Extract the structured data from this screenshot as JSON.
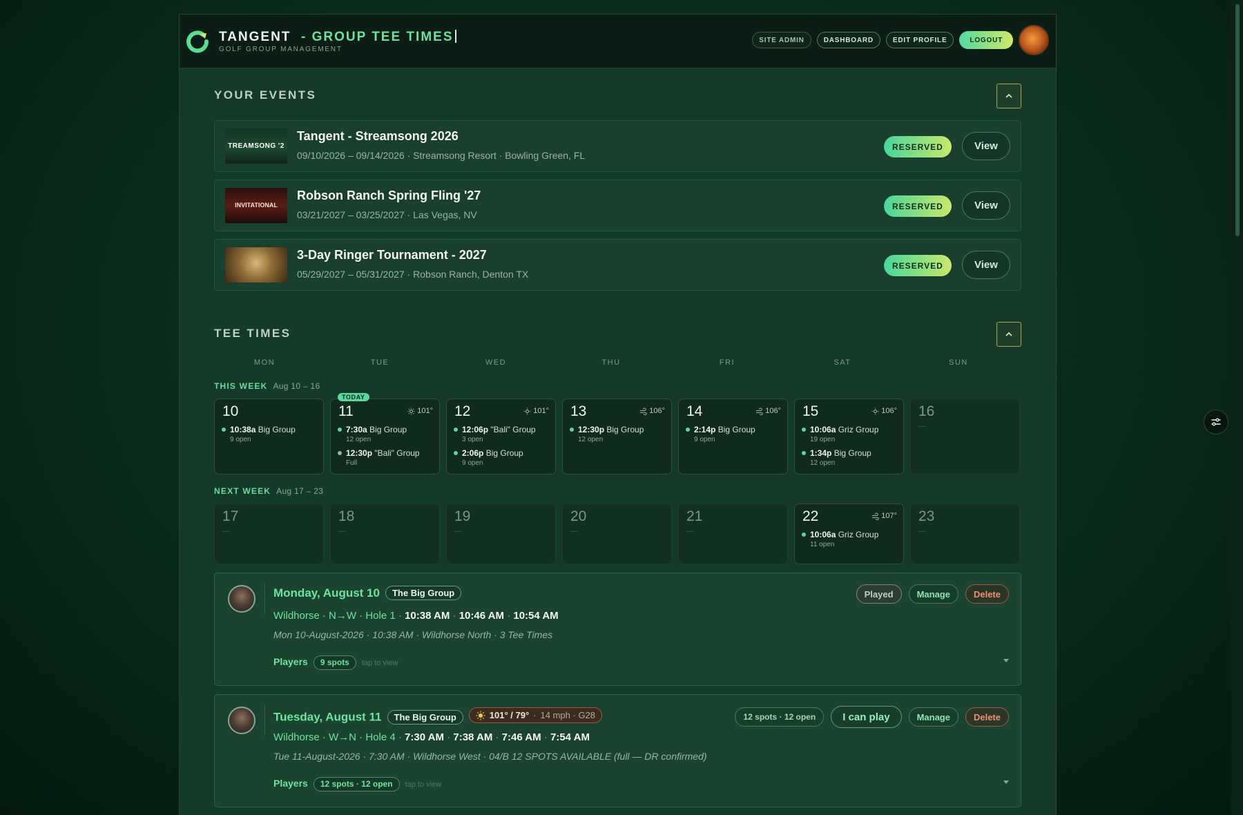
{
  "header": {
    "brand": "TANGENT",
    "brand_suffix": "- GROUP TEE TIMES",
    "subtitle": "GOLF GROUP MANAGEMENT",
    "nav": [
      "SITE ADMIN",
      "DASHBOARD",
      "EDIT PROFILE"
    ],
    "logout_label": "LOGOUT"
  },
  "events_section": {
    "title": "YOUR EVENTS",
    "items": [
      {
        "title": "Tangent - Streamsong 2026",
        "subtitle": "09/10/2026 – 09/14/2026 · Streamsong Resort · Bowling Green, FL",
        "thumb_text": "TREAMSONG '2",
        "status": "RESERVED",
        "action": "View"
      },
      {
        "title": "Robson Ranch Spring Fling '27",
        "subtitle": "03/21/2027 – 03/25/2027 · Las Vegas, NV",
        "thumb_text": "INVITATIONAL",
        "status": "RESERVED",
        "action": "View"
      },
      {
        "title": "3-Day Ringer Tournament - 2027",
        "subtitle": "05/29/2027 – 05/31/2027 · Robson Ranch, Denton TX",
        "thumb_text": "",
        "status": "RESERVED",
        "action": "View"
      }
    ]
  },
  "tee_times": {
    "title": "TEE TIMES",
    "days_of_week": [
      "MON",
      "TUE",
      "WED",
      "THU",
      "FRI",
      "SAT",
      "SUN"
    ],
    "this_week": {
      "label": "THIS WEEK",
      "range": "Aug 10 – 16"
    },
    "next_week": {
      "label": "NEXT WEEK",
      "range": "Aug 17 – 23"
    },
    "today_label": "TODAY",
    "empty_dash": "—",
    "week1": [
      {
        "num": "10",
        "slots": [
          {
            "time": "10:38a",
            "group": "Big Group",
            "sub": "9 open"
          }
        ]
      },
      {
        "num": "11",
        "weather_icon": "sun-icon",
        "temp": "101°",
        "slots": [
          {
            "time": "7:30a",
            "group": "Big Group",
            "sub": "12 open"
          },
          {
            "time": "12:30p",
            "group": "\"Bali\" Group",
            "sub": "Full"
          }
        ]
      },
      {
        "num": "12",
        "weather_icon": "sun-icon",
        "temp": "101°",
        "slots": [
          {
            "time": "12:06p",
            "group": "\"Bali\" Group",
            "sub": "3 open"
          },
          {
            "time": "2:06p",
            "group": "Big Group",
            "sub": "9 open"
          }
        ]
      },
      {
        "num": "13",
        "weather_icon": "wind-icon",
        "temp": "106°",
        "slots": [
          {
            "time": "12:30p",
            "group": "Big Group",
            "sub": "12 open"
          }
        ]
      },
      {
        "num": "14",
        "weather_icon": "wind-icon",
        "temp": "106°",
        "slots": [
          {
            "time": "2:14p",
            "group": "Big Group",
            "sub": "9 open"
          }
        ]
      },
      {
        "num": "15",
        "weather_icon": "sun-icon",
        "temp": "106°",
        "slots": [
          {
            "time": "10:06a",
            "group": "Griz Group",
            "sub": "19 open"
          },
          {
            "time": "1:34p",
            "group": "Big Group",
            "sub": "12 open"
          }
        ]
      },
      {
        "num": "16"
      }
    ],
    "week2": [
      {
        "num": "17"
      },
      {
        "num": "18"
      },
      {
        "num": "19"
      },
      {
        "num": "20"
      },
      {
        "num": "21"
      },
      {
        "num": "22",
        "weather_icon": "wind-icon",
        "temp": "107°",
        "slots": [
          {
            "time": "10:06a",
            "group": "Griz Group",
            "sub": "11 open"
          }
        ]
      },
      {
        "num": "23"
      }
    ]
  },
  "cards": [
    {
      "date": "Monday, August 10",
      "group": "The Big Group",
      "route": "Wildhorse · N→W · Hole 1",
      "times": [
        "10:38 AM",
        "10:46 AM",
        "10:54 AM"
      ],
      "note": "Mon 10-August-2026 · 10:38 AM · Wildhorse North · 3 Tee Times",
      "players_label": "Players",
      "spots": "9 spots",
      "tap": "tap to view",
      "actions": [
        "Played",
        "Manage",
        "Delete"
      ]
    },
    {
      "date": "Tuesday, August 11",
      "group": "The Big Group",
      "weather": {
        "temps": "101° / 79°",
        "wind": "14 mph · G28"
      },
      "route": "Wildhorse · W→N · Hole 4",
      "times": [
        "7:30 AM",
        "7:38 AM",
        "7:46 AM",
        "7:54 AM"
      ],
      "note": "Tue 11-August-2026 · 7:30 AM · Wildhorse West · 04/B 12 SPOTS AVAILABLE (full — DR confirmed)",
      "players_label": "Players",
      "spots": "12 spots · 12 open",
      "tap": "tap to view",
      "summary": "12 spots · 12 open",
      "play_label": "I can play",
      "actions": [
        "Manage",
        "Delete"
      ]
    }
  ],
  "colors": {
    "accent": "#6fe39d",
    "background": "#143a2a",
    "danger": "#f08f6f"
  }
}
